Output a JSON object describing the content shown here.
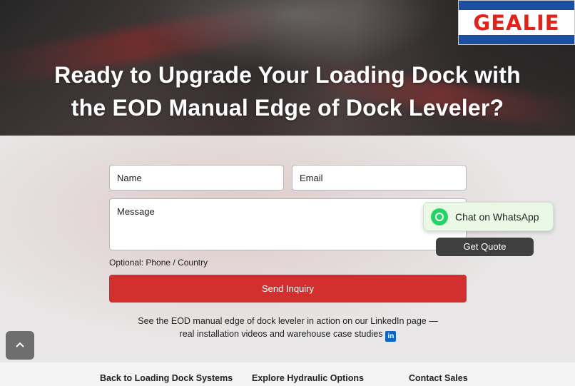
{
  "hero": {
    "title_line1": "Ready to Upgrade Your Loading Dock with",
    "title_line2": "the EOD Manual Edge of Dock Leveler?"
  },
  "logo": {
    "text": "GEALIE"
  },
  "form": {
    "name_placeholder": "Name",
    "email_placeholder": "Email",
    "message_placeholder": "Message",
    "optional_label": "Optional: Phone / Country",
    "send_label": "Send Inquiry"
  },
  "linkedin": {
    "line1": "See the EOD manual edge of dock leveler in action on our LinkedIn page —",
    "line2": "real installation videos and warehouse case studies",
    "icon": "in"
  },
  "widgets": {
    "whatsapp_label": "Chat on WhatsApp",
    "quote_label": "Get Quote"
  },
  "footer": {
    "back_label": "Back to Loading Dock Systems",
    "hydraulic_label": "Explore Hydraulic Options",
    "contact_label": "Contact Sales"
  },
  "colors": {
    "send_button": "#d32f2f",
    "whatsapp_green": "#25d366",
    "linkedin_blue": "#0a66c2",
    "logo_blue": "#1b4fa0",
    "logo_red": "#e2231a"
  }
}
